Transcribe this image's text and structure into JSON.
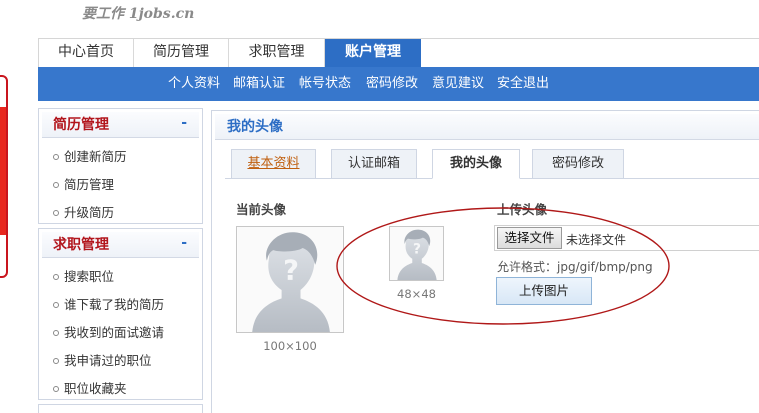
{
  "logo": {
    "text": "要工作 1jobs.cn"
  },
  "main_tabs": [
    {
      "label": "中心首页"
    },
    {
      "label": "简历管理"
    },
    {
      "label": "求职管理"
    },
    {
      "label": "账户管理",
      "active": true
    }
  ],
  "subnav": [
    {
      "label": "个人资料"
    },
    {
      "label": "邮箱认证"
    },
    {
      "label": "帐号状态"
    },
    {
      "label": "密码修改"
    },
    {
      "label": "意见建议"
    },
    {
      "label": "安全退出"
    }
  ],
  "sidebar": {
    "resume": {
      "title": "简历管理",
      "toggle": "-",
      "items": [
        {
          "label": "创建新简历"
        },
        {
          "label": "简历管理"
        },
        {
          "label": "升级简历"
        }
      ]
    },
    "job": {
      "title": "求职管理",
      "toggle": "-",
      "items": [
        {
          "label": "搜索职位"
        },
        {
          "label": "谁下载了我的简历"
        },
        {
          "label": "我收到的面试邀请"
        },
        {
          "label": "我申请过的职位"
        },
        {
          "label": "职位收藏夹"
        }
      ]
    }
  },
  "content": {
    "title": "我的头像",
    "tabs": [
      {
        "label": "基本资料",
        "style": "link"
      },
      {
        "label": "认证邮箱"
      },
      {
        "label": "我的头像",
        "active": true
      },
      {
        "label": "密码修改"
      }
    ],
    "current_avatar": {
      "label": "当前头像",
      "large_caption": "100×100",
      "small_caption": "48×48"
    },
    "upload": {
      "label": "上传头像",
      "choose_button": "选择文件",
      "file_status": "未选择文件",
      "allowed_formats": "允许格式：jpg/gif/bmp/png",
      "submit_button": "上传图片"
    }
  },
  "colors": {
    "brand_blue": "#2d6ec5",
    "subnav_blue": "#3777cc",
    "sidebar_title_red": "#b2151c",
    "annotation_red": "#b01818",
    "link_orange": "#c06010"
  },
  "icons": {
    "avatar_placeholder": "user-silhouette-question-icon",
    "collapse_toggle": "minus-icon"
  }
}
